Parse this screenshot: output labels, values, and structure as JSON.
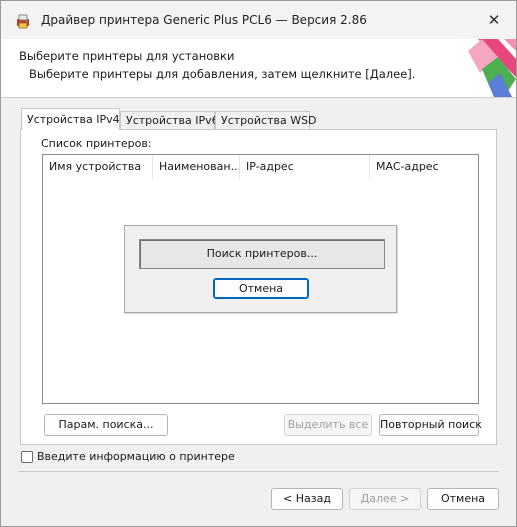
{
  "window": {
    "title": "Драйвер принтера Generic Plus PCL6 — Версия 2.86",
    "close_glyph": "✕"
  },
  "header": {
    "title": "Выберите принтеры для установки",
    "subtitle": "Выберите принтеры для добавления, затем щелкните [Далее]."
  },
  "tabs": [
    {
      "label": "Устройства IPv4",
      "active": true
    },
    {
      "label": "Устройства IPv6",
      "active": false
    },
    {
      "label": "Устройства WSD",
      "active": false
    }
  ],
  "printer_list": {
    "label": "Список принтеров:",
    "columns": [
      "Имя устройства",
      "Наименован...",
      "IP-адрес",
      "MAC-адрес"
    ]
  },
  "progress_dialog": {
    "status_text": "Поиск принтеров...",
    "cancel_label": "Отмена"
  },
  "actions": {
    "search_params_label": "Парам. поиска...",
    "select_all_label": "Выделить все",
    "research_label": "Повторный поиск"
  },
  "manual_entry": {
    "label": "Введите информацию о принтере",
    "checked": false
  },
  "footer": {
    "back_label": "< Назад",
    "next_label": "Далее >",
    "cancel_label": "Отмена"
  },
  "colors": {
    "accent": "#0067c0",
    "deco_pink": "#e8467c",
    "deco_green": "#4caf50",
    "deco_blue": "#5b7fd6"
  },
  "icons": {
    "app": "printer-driver-icon",
    "close": "close-icon"
  }
}
